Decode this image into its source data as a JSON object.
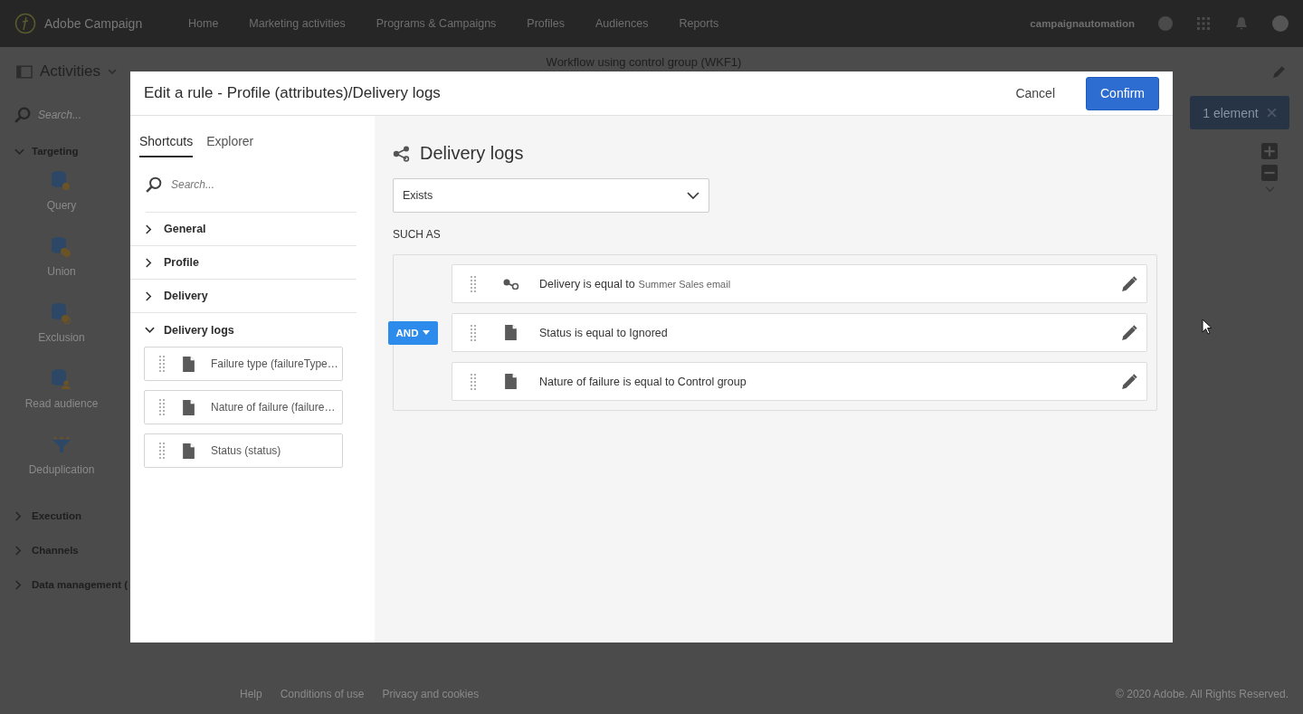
{
  "app_header": {
    "logo_text": "Adobe Campaign",
    "nav": [
      "Home",
      "Marketing activities",
      "Programs & Campaigns",
      "Profiles",
      "Audiences",
      "Reports"
    ],
    "user": "campaignautomation"
  },
  "toolbar": {
    "activities_label": "Activities",
    "workflow_title": "Workflow using control group (WKF1)",
    "selection_badge": "1 element"
  },
  "sidebar": {
    "search_placeholder": "Search...",
    "sections": [
      {
        "label": "Targeting",
        "expanded": true,
        "items": [
          {
            "label": "Query",
            "kind": "query"
          },
          {
            "label": "Union",
            "kind": "union"
          },
          {
            "label": "Exclusion",
            "kind": "exclusion"
          },
          {
            "label": "Read audience",
            "kind": "audience"
          },
          {
            "label": "Deduplication",
            "kind": "dedup"
          }
        ]
      },
      {
        "label": "Execution",
        "expanded": false
      },
      {
        "label": "Channels",
        "expanded": false
      },
      {
        "label": "Data management (",
        "expanded": false
      }
    ]
  },
  "footer": {
    "links": [
      "Help",
      "Conditions of use",
      "Privacy and cookies"
    ],
    "copyright": "© 2020 Adobe. All Rights Reserved."
  },
  "dialog": {
    "title": "Edit a rule - Profile (attributes)/Delivery logs",
    "cancel": "Cancel",
    "confirm": "Confirm",
    "tabs": [
      {
        "label": "Shortcuts",
        "selected": true
      },
      {
        "label": "Explorer",
        "selected": false
      }
    ],
    "search_placeholder": "Search...",
    "tree": [
      {
        "label": "General",
        "expanded": false
      },
      {
        "label": "Profile",
        "expanded": false
      },
      {
        "label": "Delivery",
        "expanded": false
      },
      {
        "label": "Delivery logs",
        "expanded": true,
        "children": [
          {
            "label": "Failure type (failureType…"
          },
          {
            "label": "Nature of failure (failure…"
          },
          {
            "label": "Status (status)"
          }
        ]
      }
    ],
    "panel": {
      "title": "Delivery logs",
      "operator": "Exists",
      "such_as": "SUCH AS",
      "logic": "AND",
      "conditions": [
        {
          "kind": "link",
          "text": "Delivery is equal to",
          "value": "Summer Sales email"
        },
        {
          "kind": "field",
          "text": "Status is equal to Ignored"
        },
        {
          "kind": "field",
          "text": "Nature of failure is equal to Control group"
        }
      ]
    }
  }
}
